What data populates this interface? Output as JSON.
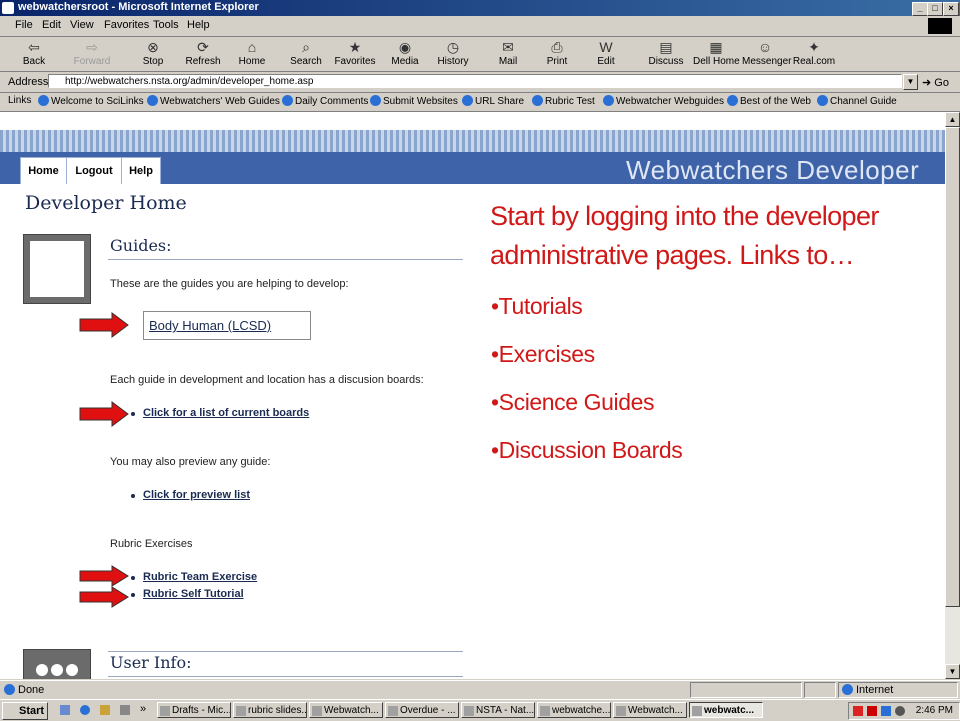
{
  "window": {
    "title": "webwatchersroot - Microsoft Internet Explorer"
  },
  "menu": [
    "File",
    "Edit",
    "View",
    "Favorites",
    "Tools",
    "Help"
  ],
  "toolbar": [
    {
      "label": "Back",
      "icon": "back-arrow-icon"
    },
    {
      "label": "Forward",
      "icon": "forward-arrow-icon"
    },
    {
      "label": "Stop",
      "icon": "stop-icon"
    },
    {
      "label": "Refresh",
      "icon": "refresh-icon"
    },
    {
      "label": "Home",
      "icon": "home-icon"
    },
    {
      "label": "Search",
      "icon": "search-icon"
    },
    {
      "label": "Favorites",
      "icon": "favorites-icon"
    },
    {
      "label": "Media",
      "icon": "media-icon"
    },
    {
      "label": "History",
      "icon": "history-icon"
    },
    {
      "label": "Mail",
      "icon": "mail-icon"
    },
    {
      "label": "Print",
      "icon": "print-icon"
    },
    {
      "label": "Edit",
      "icon": "edit-icon"
    },
    {
      "label": "Discuss",
      "icon": "discuss-icon"
    },
    {
      "label": "Dell Home",
      "icon": "dell-icon"
    },
    {
      "label": "Messenger",
      "icon": "messenger-icon"
    },
    {
      "label": "Real.com",
      "icon": "real-icon"
    }
  ],
  "address": {
    "label": "Address",
    "url": "http://webwatchers.nsta.org/admin/developer_home.asp",
    "go": "Go"
  },
  "links": {
    "label": "Links",
    "items": [
      "Welcome to SciLinks",
      "Webwatchers' Web Guides",
      "Daily Comments",
      "Submit Websites",
      "URL Share",
      "Rubric Test",
      "Webwatcher Webguides",
      "Best of the Web",
      "Channel Guide"
    ]
  },
  "site": {
    "brand": "Webwatchers Developer",
    "nav": [
      "Home",
      "Logout",
      "Help"
    ],
    "page_title": "Developer Home",
    "guides": {
      "heading": "Guides:",
      "intro": "These are the guides you are helping to develop:",
      "guide_link": "Body Human (LCSD)",
      "boards_text": "Each guide in development and location has a discusion boards:",
      "boards_link": "Click for a list of current boards",
      "preview_text": "You may also preview any guide:",
      "preview_link": "Click for preview list",
      "rubric_heading": "Rubric Exercises",
      "rubric_links": [
        "Rubric Team Exercise",
        "Rubric Self Tutorial"
      ]
    },
    "userinfo_heading": "User Info:"
  },
  "annotation": {
    "line1": "Start by logging into the developer",
    "line2": "administrative pages. Links to…",
    "bullets": [
      "•Tutorials",
      "•Exercises",
      "•Science Guides",
      "•Discussion Boards"
    ],
    "color": "#d11818"
  },
  "status": {
    "text": "Done",
    "zone": "Internet"
  },
  "taskbar": {
    "start": "Start",
    "tasks": [
      "Drafts - Mic...",
      "rubric slides...",
      "Webwatch...",
      "Overdue - ...",
      "NSTA - Nat...",
      "webwatche...",
      "Webwatch...",
      "webwatc..."
    ],
    "clock": "2:46 PM"
  }
}
